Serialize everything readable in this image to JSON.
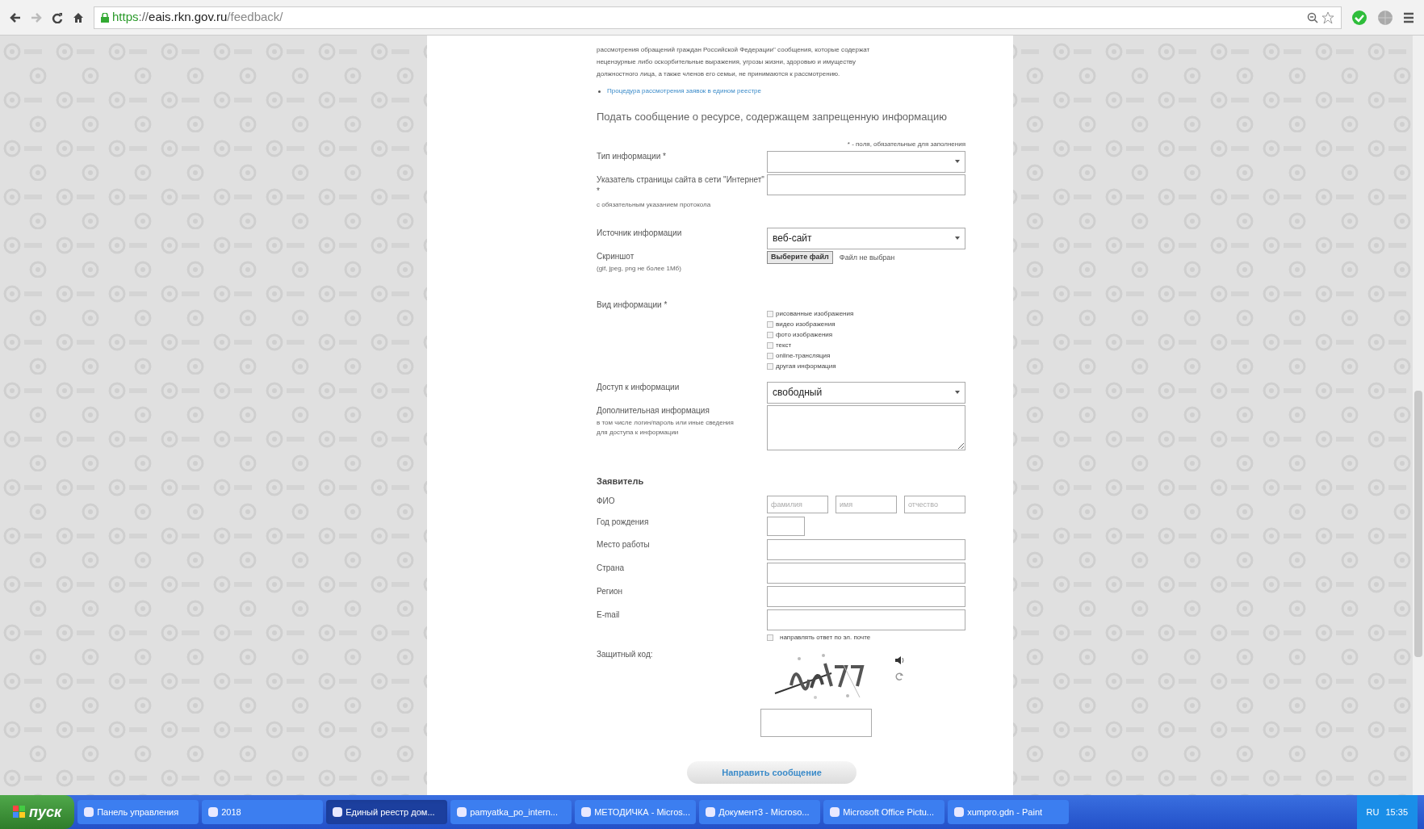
{
  "browser": {
    "url": {
      "scheme": "https",
      "rest": "://",
      "host": "eais.rkn.gov.ru",
      "path": "/feedback/"
    }
  },
  "intro": {
    "lines": [
      "рассмотрения обращений граждан Российской Федерации\" сообщения, которые содержат",
      "нецензурные либо оскорбительные выражения, угрозы жизни, здоровью и имуществу",
      "должностного лица, а также членов его семьи, не принимаются к рассмотрению."
    ],
    "link": "Процедура рассмотрения заявок в едином реестре"
  },
  "form": {
    "heading": "Подать сообщение о ресурсе, содержащем запрещенную информацию",
    "required_note": "* - поля, обязательные для заполнения",
    "fields": [
      {
        "kind": "select",
        "label": "Тип информации *"
      },
      {
        "kind": "text",
        "label": "Указатель страницы сайта в сети \"Интернет\" *",
        "hint": "с обязательным указанием протокола"
      },
      {
        "kind": "select",
        "label": "Источник информации",
        "value": "веб-сайт"
      },
      {
        "kind": "file",
        "label": "Скриншот",
        "hint": "(gif, jpeg, png не более 1Мб)",
        "button": "Выберите файл",
        "status": "Файл не выбран"
      },
      {
        "kind": "checkboxes",
        "label": "Вид информации *",
        "options": [
          {
            "label": "рисованные изображения",
            "checked": false
          },
          {
            "label": "видео изображения",
            "checked": false
          },
          {
            "label": "фото изображения",
            "checked": false
          },
          {
            "label": "текст",
            "checked": false
          },
          {
            "label": "online-трансляция",
            "checked": false
          },
          {
            "label": "другая информация",
            "checked": false
          }
        ]
      },
      {
        "kind": "select",
        "label": "Доступ к информации",
        "value": "свободный"
      },
      {
        "kind": "textarea",
        "label": "Дополнительная информация",
        "hint": "в том числе логин/пароль или иные сведения для доступа к информации"
      },
      {
        "kind": "section",
        "label": "Заявитель"
      },
      {
        "kind": "triple",
        "label": "ФИО",
        "placeholders": [
          "фамилия",
          "имя",
          "отчество"
        ]
      },
      {
        "kind": "short",
        "label": "Год рождения"
      },
      {
        "kind": "text",
        "label": "Место работы"
      },
      {
        "kind": "text",
        "label": "Страна"
      },
      {
        "kind": "text",
        "label": "Регион"
      },
      {
        "kind": "text",
        "label": "E-mail"
      },
      {
        "kind": "check",
        "label": "направлять ответ по эл. почте",
        "checked": false
      },
      {
        "kind": "captcha",
        "label": "Защитный код:"
      }
    ],
    "submit": "Направить сообщение"
  },
  "taskbar": {
    "start": "пуск",
    "items": [
      {
        "label": "Панель управления",
        "selected": false
      },
      {
        "label": "2018",
        "selected": false
      },
      {
        "label": "Единый реестр дом...",
        "selected": true
      },
      {
        "label": "pamyatka_po_intern...",
        "selected": false
      },
      {
        "label": "МЕТОДИЧКА - Micros...",
        "selected": false
      },
      {
        "label": "Документ3 - Microso...",
        "selected": false
      },
      {
        "label": "Microsoft Office Pictu...",
        "selected": false
      },
      {
        "label": "xumpro.gdn - Paint",
        "selected": false
      }
    ],
    "lang": "RU",
    "time": "15:35"
  }
}
